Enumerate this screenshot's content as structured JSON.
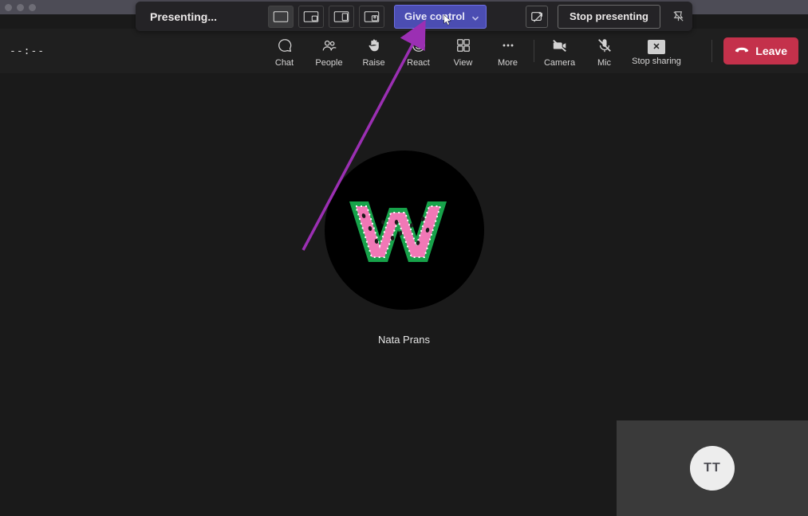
{
  "titlebar": {},
  "presenter": {
    "status": "Presenting...",
    "give_control_label": "Give control",
    "stop_presenting_label": "Stop presenting"
  },
  "meeting": {
    "timer": "--:--",
    "tools": {
      "chat": "Chat",
      "people": "People",
      "raise": "Raise",
      "react": "React",
      "view": "View",
      "more": "More",
      "camera": "Camera",
      "mic": "Mic",
      "stop_sharing": "Stop sharing"
    },
    "leave_label": "Leave"
  },
  "participant": {
    "display_name": "Nata Prans",
    "avatar_letter": "W"
  },
  "self": {
    "initials": "TT"
  },
  "colors": {
    "accent_purple": "#4b4db2",
    "leave_red": "#c4314b",
    "annotation": "#9b2fb3"
  }
}
